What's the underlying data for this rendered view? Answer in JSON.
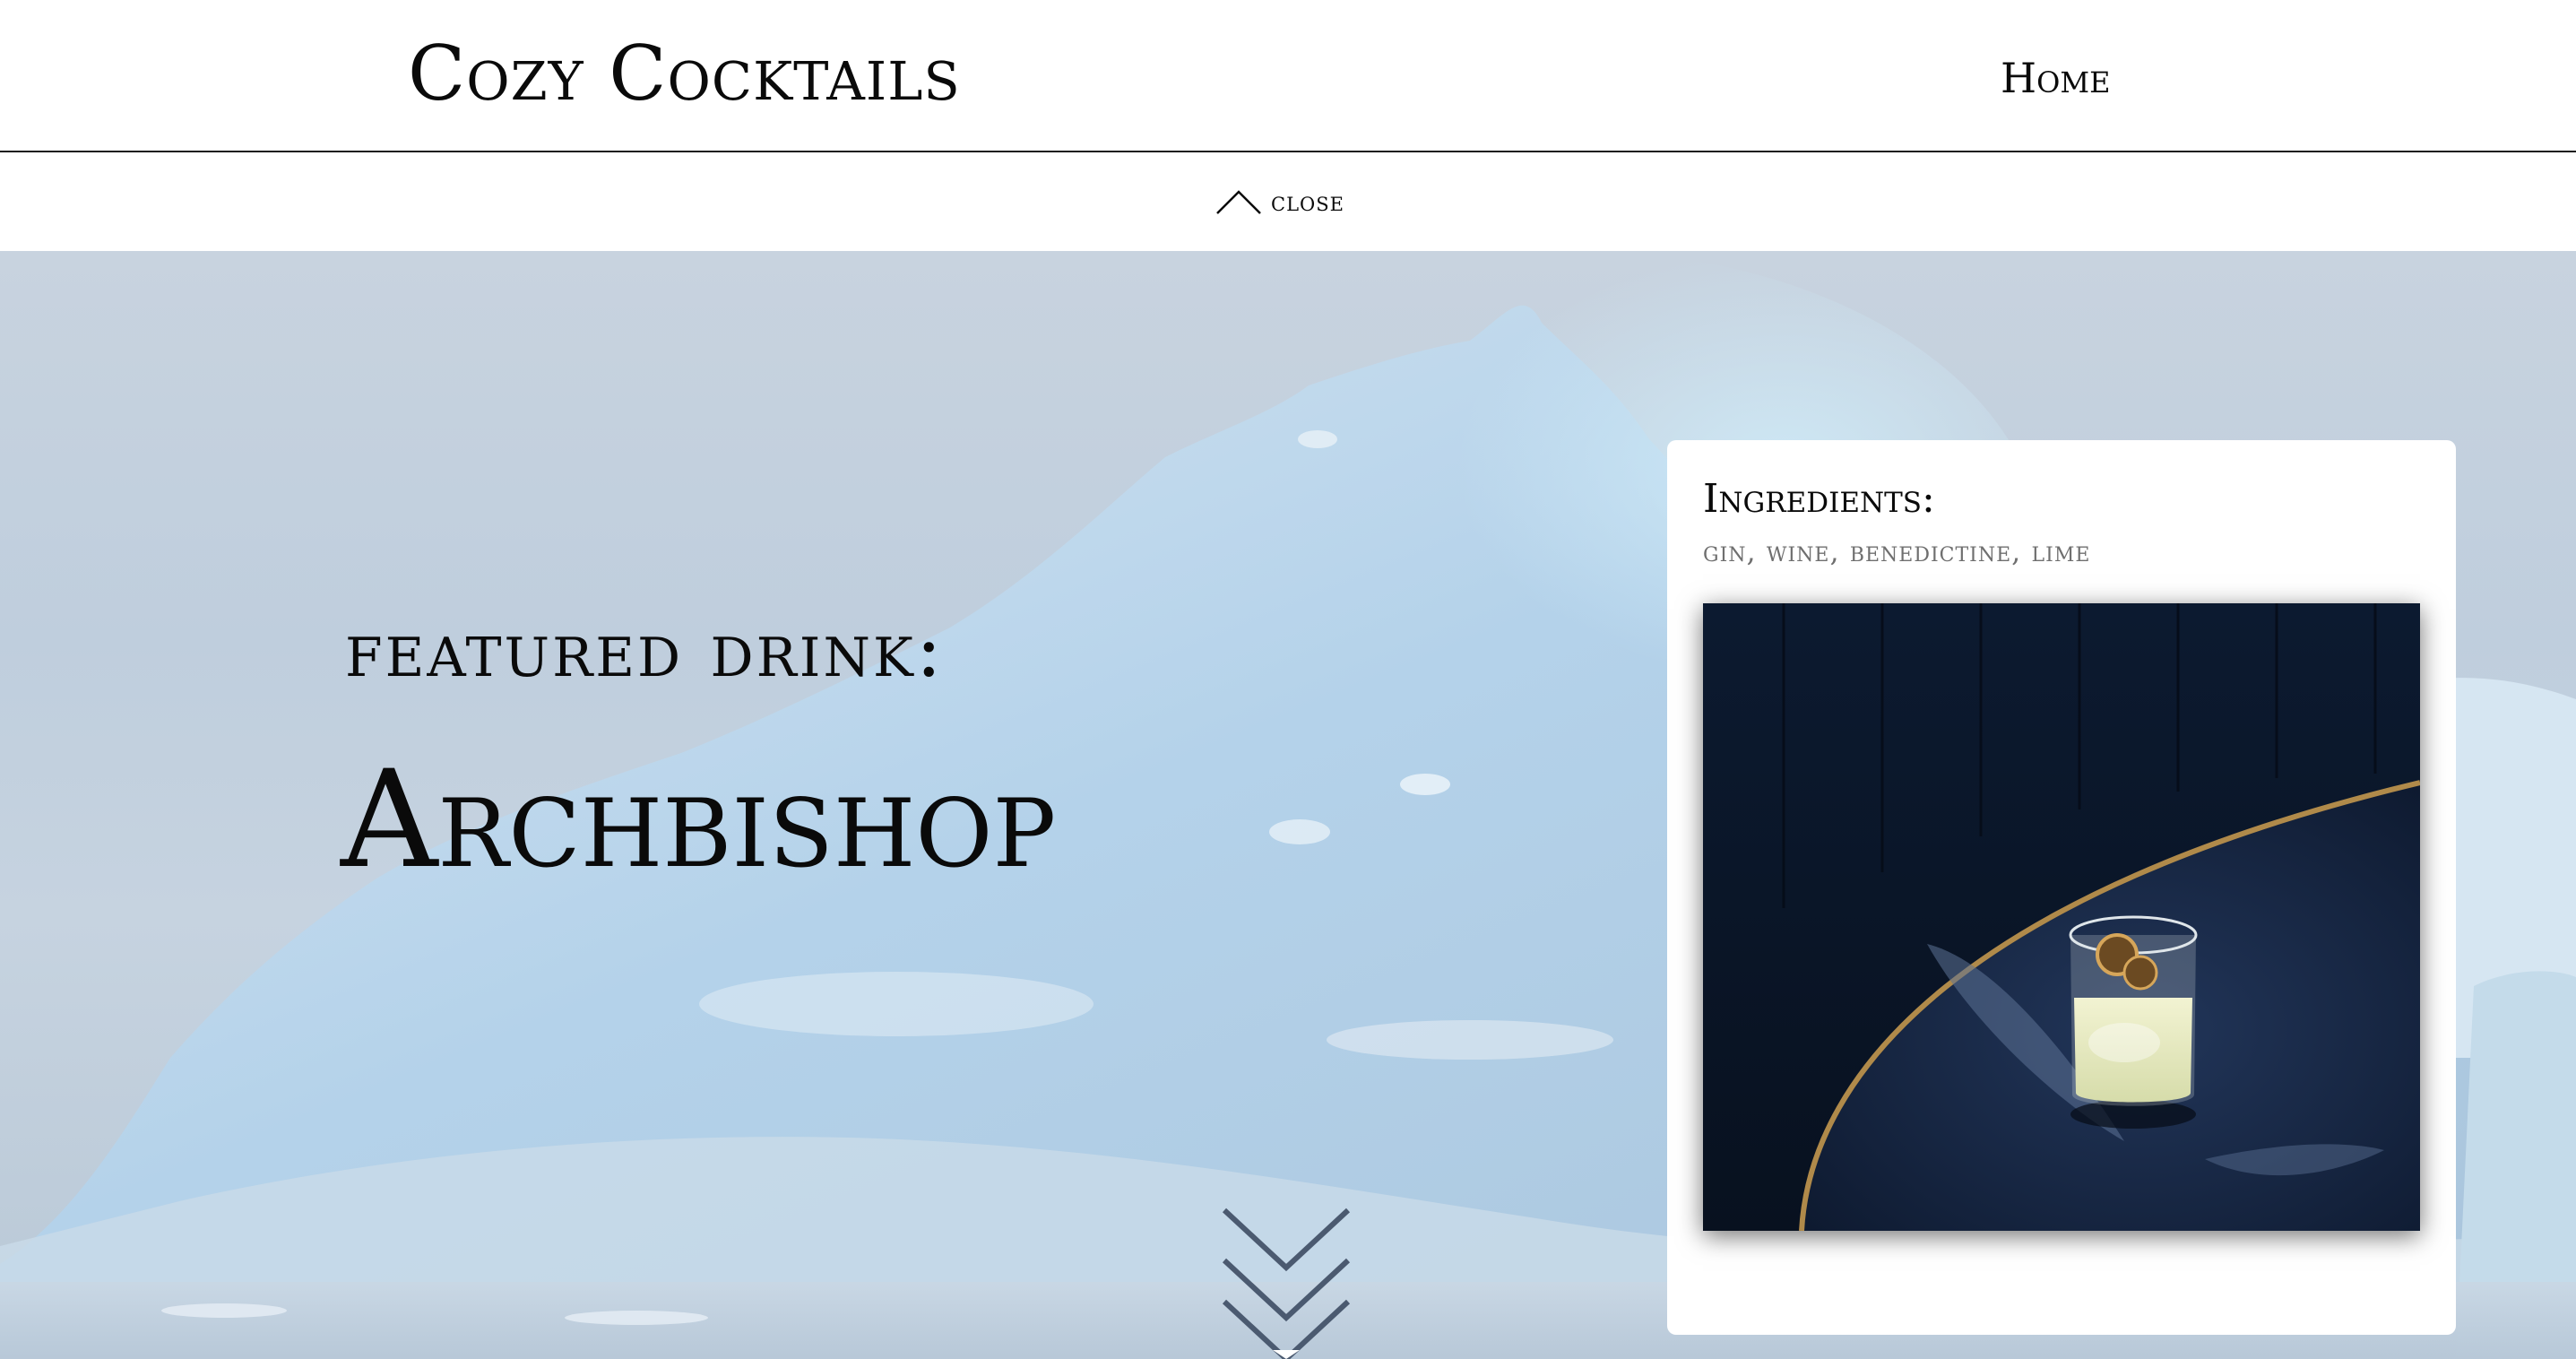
{
  "header": {
    "brand": "Cozy Cocktails",
    "nav": {
      "home_label": "Home"
    }
  },
  "close_bar": {
    "label": "CLOSE",
    "icon": "chevron-up-icon"
  },
  "hero": {
    "featured_label": "FEATURED DRINK:",
    "drink_name": "Archbishop",
    "scroll_icon": "double-chevron-down-icon"
  },
  "card": {
    "ingredients_title": "Ingredients:",
    "ingredients_list": "GIN, WINE, BENEDICTINE, LIME",
    "photo_icon": "cocktail-photo"
  },
  "colors": {
    "text": "#0a0a0a",
    "muted": "#6f6f6f",
    "hero_sky": "#c8d3df",
    "ice": "#b8d4ea",
    "booth": "#0f1c33",
    "table_rim": "#b08a4a"
  }
}
